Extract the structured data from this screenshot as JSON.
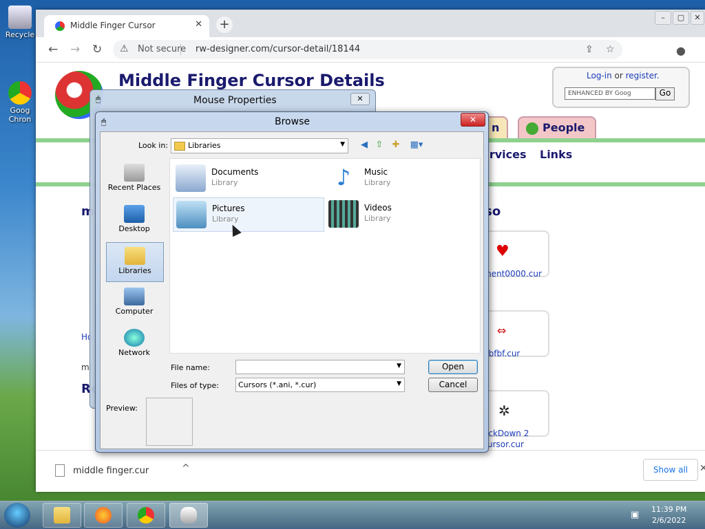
{
  "desktop": {
    "recycle_label": "Recycle",
    "chrome_label_1": "Goog",
    "chrome_label_2": "Chron"
  },
  "browser": {
    "tab_title": "Middle Finger Cursor",
    "tab_close": "✕",
    "new_tab": "+",
    "not_secure": "Not secure",
    "url": "rw-designer.com/cursor-detail/18144",
    "win_min": "–",
    "win_max": "▢",
    "win_close": "✕"
  },
  "page": {
    "title": "Middle Finger Cursor Details",
    "login_link": "Log-in",
    "or": " or ",
    "register_link": "register.",
    "search_placeholder": "ENHANCED BY Goog",
    "go_label": "Go",
    "nav_people": "People",
    "nav_partial": "n",
    "menu_services": "ervices",
    "menu_links": "Links",
    "see_also": "lso",
    "cursor_names": [
      "ment0000.cur",
      "nbfbf.cur",
      "ackDown 2",
      "ursor.cur"
    ],
    "left_partials": [
      "m",
      "Ho",
      "mi",
      "Re"
    ]
  },
  "download_bar": {
    "file_name": "middle finger.cur",
    "show_all": "Show all",
    "chevron": "^",
    "close": "✕"
  },
  "mouse_properties": {
    "title": "Mouse Properties",
    "close": "✕"
  },
  "browse": {
    "title": "Browse",
    "close": "✕",
    "look_in_label": "Look in:",
    "look_in_value": "Libraries",
    "places": [
      {
        "label": "Recent Places",
        "icon": "recent-places-icon"
      },
      {
        "label": "Desktop",
        "icon": "desktop-icon"
      },
      {
        "label": "Libraries",
        "icon": "libraries-icon"
      },
      {
        "label": "Computer",
        "icon": "computer-icon"
      },
      {
        "label": "Network",
        "icon": "network-icon"
      }
    ],
    "items": [
      {
        "name": "Documents",
        "sub": "Library",
        "icon": "documents-icon"
      },
      {
        "name": "Music",
        "sub": "Library",
        "icon": "music-icon"
      },
      {
        "name": "Pictures",
        "sub": "Library",
        "icon": "pictures-icon"
      },
      {
        "name": "Videos",
        "sub": "Library",
        "icon": "videos-icon"
      }
    ],
    "file_name_label": "File name:",
    "file_name_value": "",
    "files_of_type_label": "Files of type:",
    "files_of_type_value": "Cursors (*.ani, *.cur)",
    "open_label": "Open",
    "cancel_label": "Cancel",
    "preview_label": "Preview:"
  },
  "taskbar": {
    "time": "11:39 PM",
    "date": "2/6/2022"
  }
}
